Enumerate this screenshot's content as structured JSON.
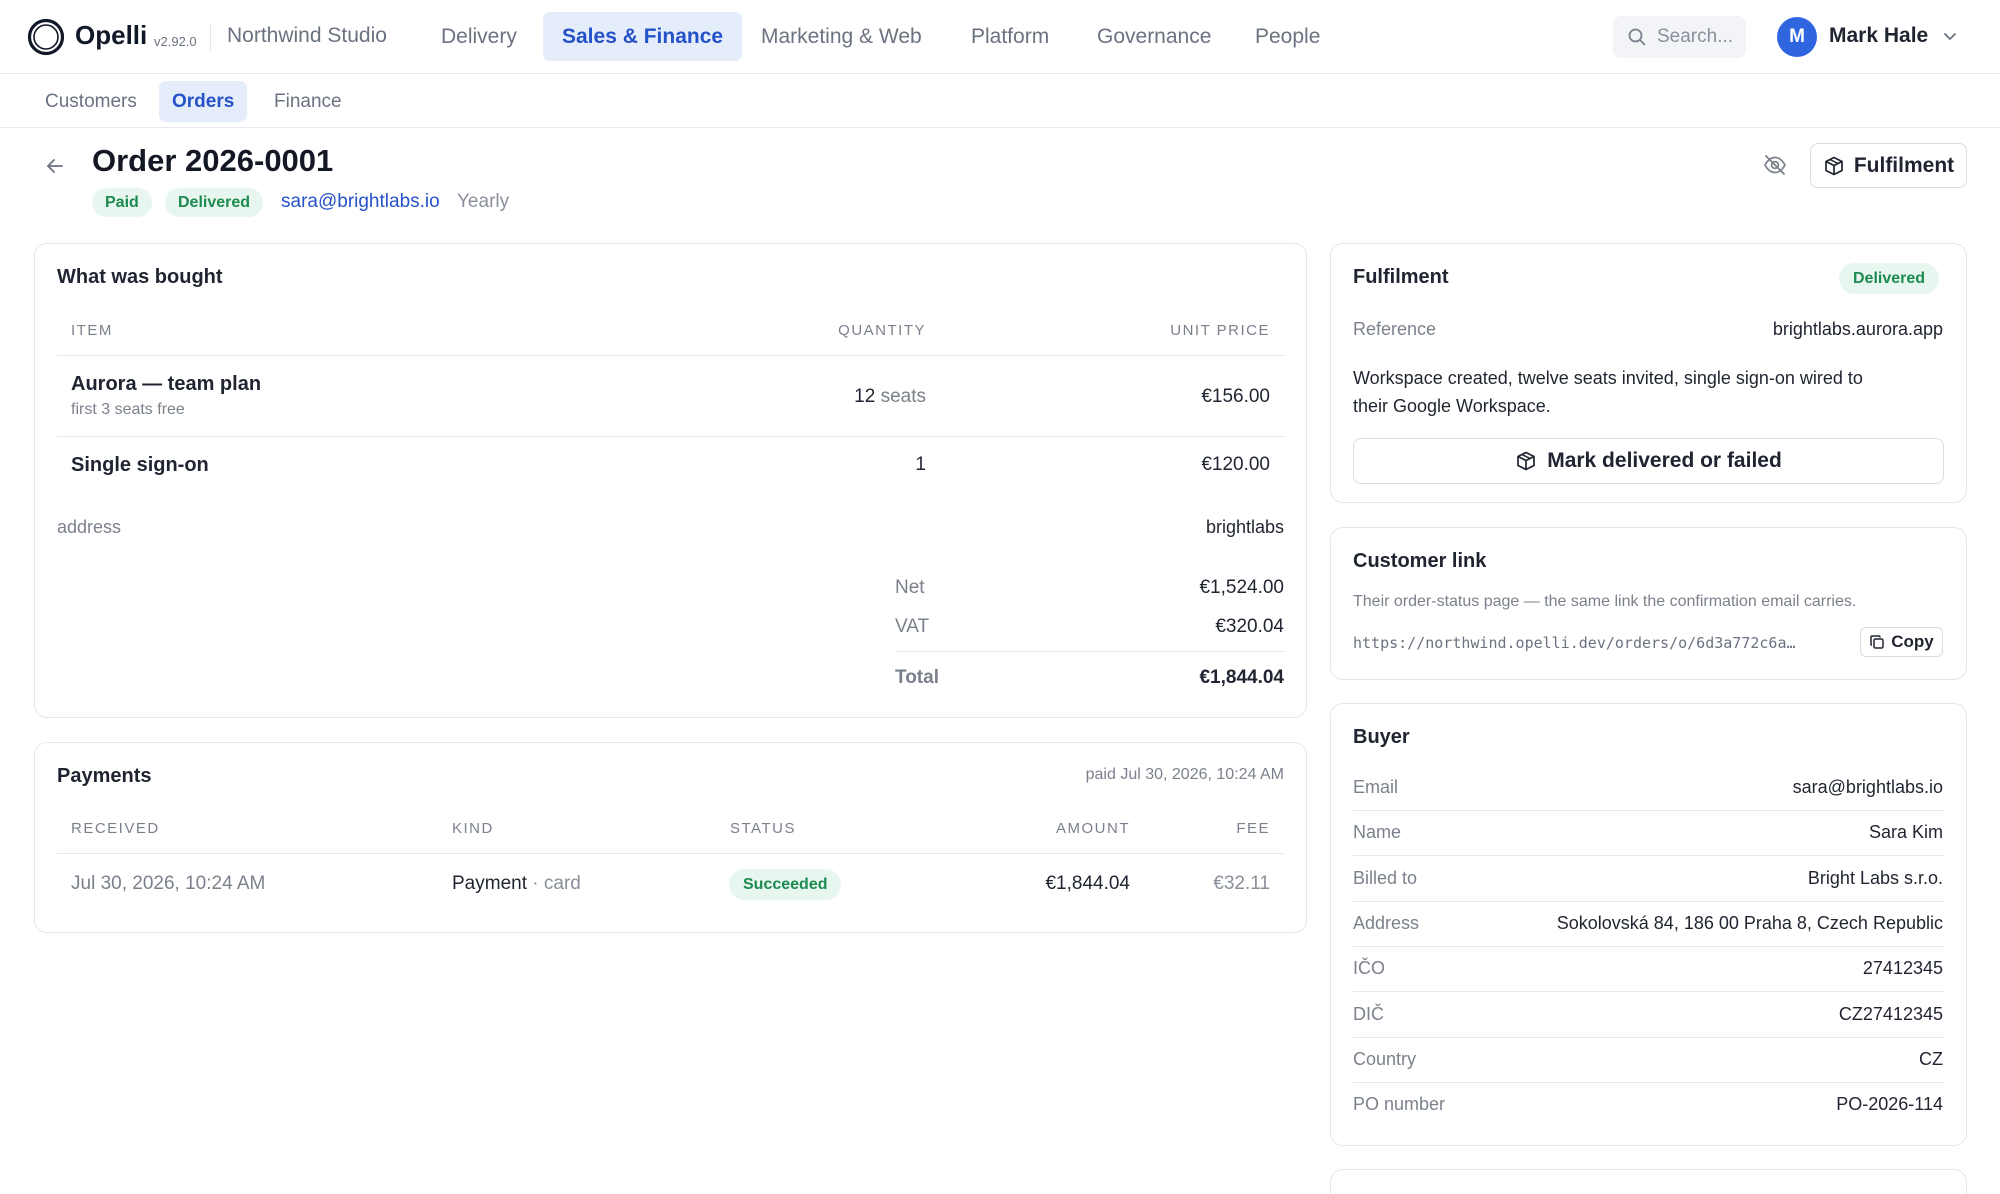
{
  "app": {
    "brand": "Opelli",
    "version": "v2.92.0",
    "workspace": "Northwind Studio"
  },
  "nav": {
    "items": [
      {
        "label": "Delivery"
      },
      {
        "label": "Sales & Finance",
        "active": true
      },
      {
        "label": "Marketing & Web"
      },
      {
        "label": "Platform"
      },
      {
        "label": "Governance"
      },
      {
        "label": "People"
      }
    ],
    "search_placeholder": "Search..."
  },
  "user": {
    "initial": "M",
    "name": "Mark Hale"
  },
  "subnav": {
    "tabs": [
      {
        "label": "Customers"
      },
      {
        "label": "Orders",
        "active": true
      },
      {
        "label": "Finance"
      }
    ]
  },
  "order": {
    "title": "Order 2026-0001",
    "badges": [
      "Paid",
      "Delivered"
    ],
    "email": "sara@brightlabs.io",
    "billing_cycle": "Yearly",
    "fulfilment_button": "Fulfilment"
  },
  "items_card": {
    "title": "What was bought",
    "headers": {
      "item": "ITEM",
      "quantity": "QUANTITY",
      "unit_price": "UNIT PRICE"
    },
    "rows": [
      {
        "name": "Aurora — team plan",
        "note": "first 3 seats free",
        "qty": "12",
        "qty_unit": "seats",
        "price": "€156.00"
      },
      {
        "name": "Single sign-on",
        "note": "",
        "qty": "1",
        "qty_unit": "",
        "price": "€120.00"
      }
    ],
    "address_label": "address",
    "address_value": "brightlabs",
    "totals": {
      "net_label": "Net",
      "net": "€1,524.00",
      "vat_label": "VAT",
      "vat": "€320.04",
      "total_label": "Total",
      "total": "€1,844.04"
    }
  },
  "payments_card": {
    "title": "Payments",
    "paid_note": "paid Jul 30, 2026, 10:24 AM",
    "headers": {
      "received": "RECEIVED",
      "kind": "KIND",
      "status": "STATUS",
      "amount": "AMOUNT",
      "fee": "FEE"
    },
    "rows": [
      {
        "received": "Jul 30, 2026, 10:24 AM",
        "kind": "Payment",
        "method": "· card",
        "status": "Succeeded",
        "amount": "€1,844.04",
        "fee": "€32.11"
      }
    ]
  },
  "fulfilment_card": {
    "title": "Fulfilment",
    "status": "Delivered",
    "reference_label": "Reference",
    "reference_value": "brightlabs.aurora.app",
    "description_line1": "Workspace created, twelve seats invited, single sign-on wired to",
    "description_line2": "their Google Workspace.",
    "action_button": "Mark delivered or failed"
  },
  "customer_link_card": {
    "title": "Customer link",
    "description": "Their order-status page — the same link the confirmation email carries.",
    "url": "https://northwind.opelli.dev/orders/o/6d3a772c6a…",
    "copy_label": "Copy"
  },
  "buyer_card": {
    "title": "Buyer",
    "fields": [
      {
        "label": "Email",
        "value": "sara@brightlabs.io"
      },
      {
        "label": "Name",
        "value": "Sara Kim"
      },
      {
        "label": "Billed to",
        "value": "Bright Labs s.r.o."
      },
      {
        "label": "Address",
        "value": "Sokolovská 84, 186 00 Praha 8, Czech Republic"
      },
      {
        "label": "IČO",
        "value": "27412345"
      },
      {
        "label": "DIČ",
        "value": "CZ27412345"
      },
      {
        "label": "Country",
        "value": "CZ"
      },
      {
        "label": "PO number",
        "value": "PO-2026-114"
      }
    ]
  },
  "colors": {
    "accent": "#2552c8",
    "accent_bg": "#e5edfb",
    "success": "#1d8a50",
    "success_bg": "#e7f6ee",
    "avatar": "#2f66e0"
  },
  "icons": [
    "app-logo-icon",
    "search-icon",
    "chevron-down-icon",
    "arrow-left-icon",
    "eye-off-icon",
    "package-icon",
    "copy-icon"
  ]
}
